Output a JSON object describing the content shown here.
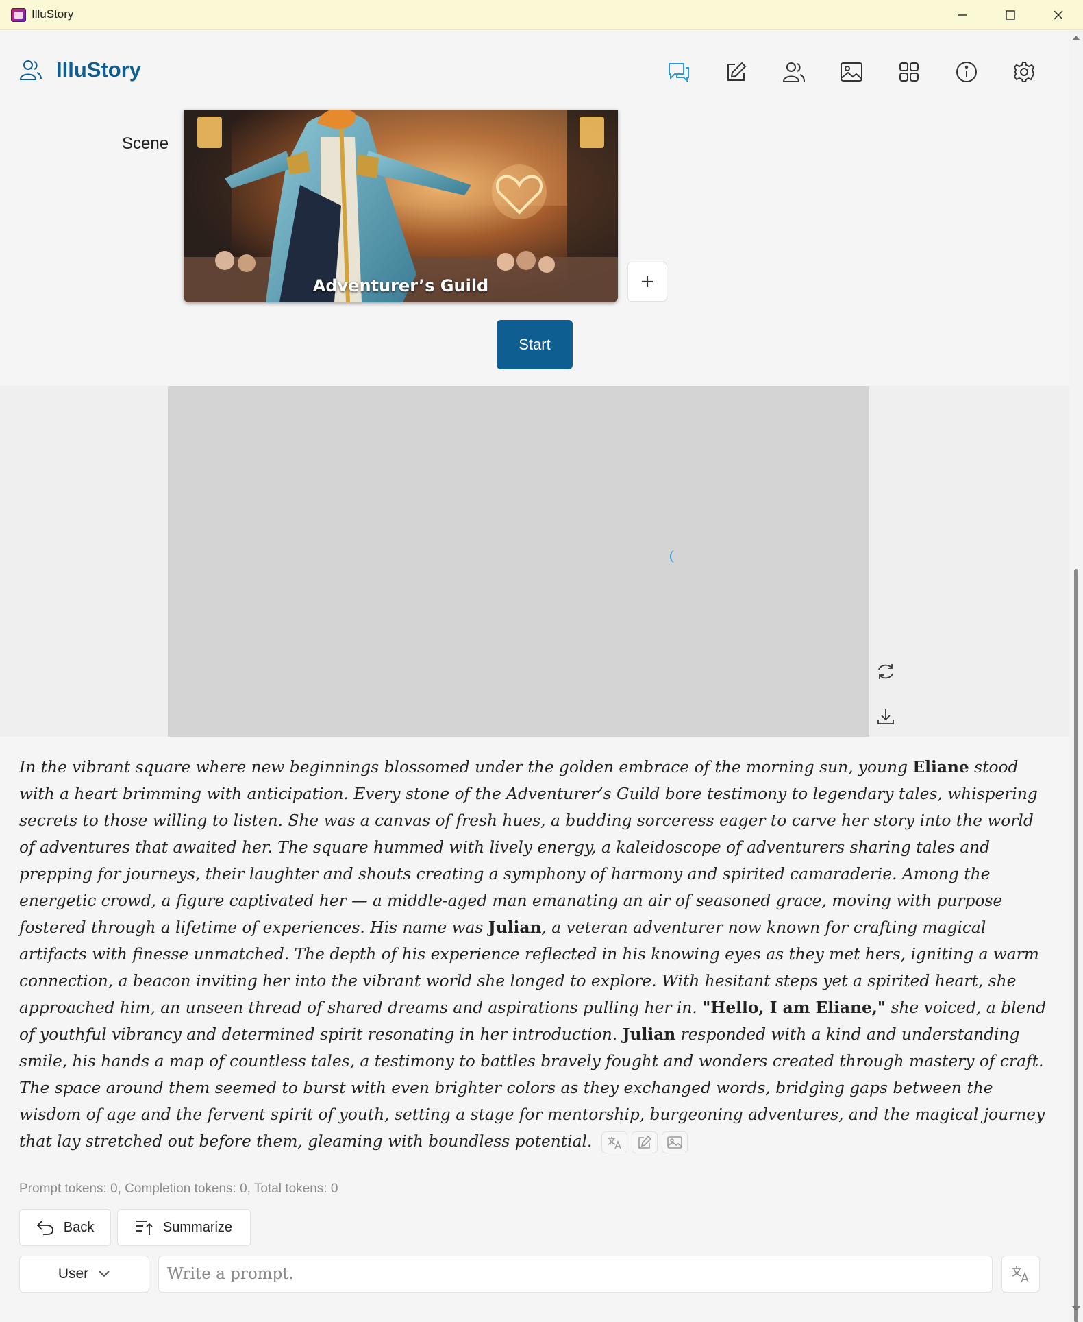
{
  "window": {
    "title": "IlluStory"
  },
  "header": {
    "brand": "IlluStory"
  },
  "nav": {
    "items": [
      {
        "name": "chat",
        "icon": "chat-icon",
        "active": true
      },
      {
        "name": "edit",
        "icon": "edit-icon",
        "active": false
      },
      {
        "name": "characters",
        "icon": "users-icon",
        "active": false
      },
      {
        "name": "images",
        "icon": "image-icon",
        "active": false
      },
      {
        "name": "apps",
        "icon": "grid-icon",
        "active": false
      },
      {
        "name": "info",
        "icon": "info-icon",
        "active": false
      },
      {
        "name": "settings",
        "icon": "gear-icon",
        "active": false
      }
    ]
  },
  "scene": {
    "label": "Scene",
    "card_title": "Adventurer’s Guild",
    "add_label": "+",
    "start_label": "Start"
  },
  "story": {
    "segments": [
      {
        "t": "In the vibrant square where new beginnings blossomed under the golden embrace of the morning sun, young ",
        "b": false
      },
      {
        "t": "Eliane",
        "b": true
      },
      {
        "t": " stood with a heart brimming with anticipation. Every stone of the Adventurer’s Guild bore testimony to legendary tales, whispering secrets to those willing to listen. She was a canvas of fresh hues, a budding sorceress eager to carve her story into the world of adventures that awaited her. The square hummed with lively energy, a kaleidoscope of adventurers sharing tales and prepping for journeys, their laughter and shouts creating a symphony of harmony and spirited camaraderie. Among the energetic crowd, a figure captivated her — a middle-aged man emanating an air of seasoned grace, moving with purpose fostered through a lifetime of experiences. His name was ",
        "b": false
      },
      {
        "t": "Julian",
        "b": true
      },
      {
        "t": ", a veteran adventurer now known for crafting magical artifacts with finesse unmatched. The depth of his experience reflected in his knowing eyes as they met hers, igniting a warm connection, a beacon inviting her into the vibrant world she longed to explore. With hesitant steps yet a spirited heart, she approached him, an unseen thread of shared dreams and aspirations pulling her in. ",
        "b": false
      },
      {
        "t": "\"Hello, I am Eliane,\"",
        "b": true
      },
      {
        "t": " she voiced, a blend of youthful vibrancy and determined spirit resonating in her introduction. ",
        "b": false
      },
      {
        "t": "Julian",
        "b": true
      },
      {
        "t": " responded with a kind and understanding smile, his hands a map of countless tales, a testimony to battles bravely fought and wonders created through mastery of craft. The space around them seemed to burst with even brighter colors as they exchanged words, bridging gaps between the wisdom of age and the fervent spirit of youth, setting a stage for mentorship, burgeoning adventures, and the magical journey that lay stretched out before them, gleaming with boundless potential.",
        "b": false
      }
    ]
  },
  "footer": {
    "tokens": "Prompt tokens: 0, Completion tokens: 0, Total tokens: 0",
    "back_label": "Back",
    "summarize_label": "Summarize",
    "role_value": "User",
    "prompt_placeholder": "Write a prompt."
  },
  "colors": {
    "accent": "#0e5e91",
    "active_nav": "#2a9bd8",
    "titlebar": "#fbf8d5"
  }
}
